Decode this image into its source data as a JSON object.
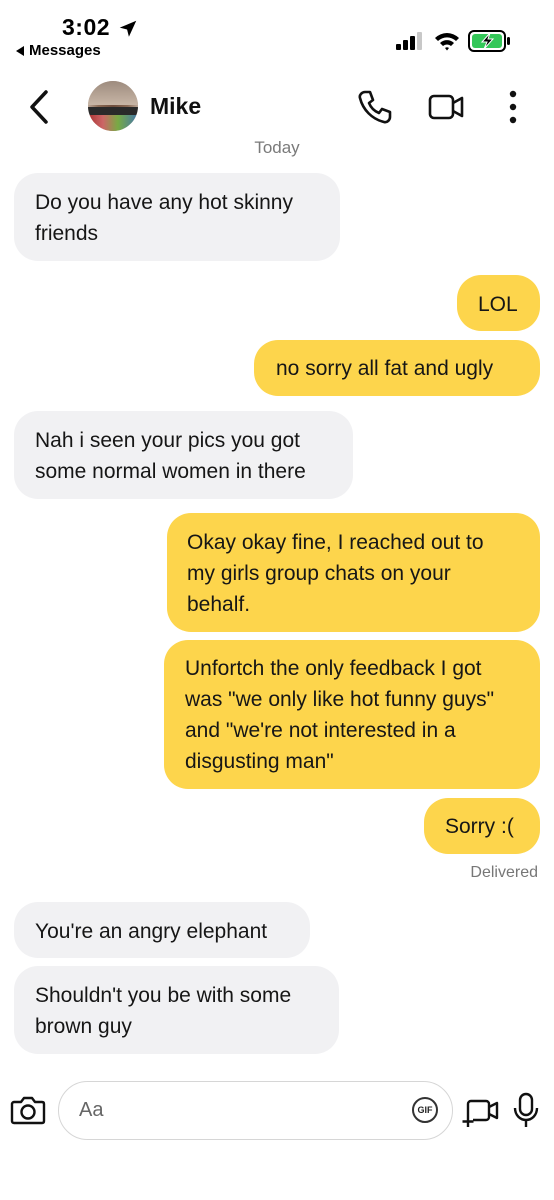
{
  "status_bar": {
    "time": "3:02",
    "back_app_label": "Messages"
  },
  "header": {
    "contact_name": "Mike"
  },
  "conversation": {
    "date_label": "Today",
    "messages": [
      {
        "side": "in",
        "text": "Do you have any hot skinny\nfriends"
      },
      {
        "side": "out",
        "text": "LOL"
      },
      {
        "side": "out",
        "text": "no sorry all fat and ugly"
      },
      {
        "side": "in",
        "text": "Nah i seen your pics you got\nsome normal women in there"
      },
      {
        "side": "out",
        "text": "Okay okay fine, I reached out to\nmy girls group chats on your\nbehalf."
      },
      {
        "side": "out",
        "text": "Unfortch the only feedback I got\nwas \"we only like hot funny guys\"\nand \"we're not interested in a\ndisgusting man\""
      },
      {
        "side": "out",
        "text": "Sorry :("
      },
      {
        "side": "in",
        "text": "You're an angry elephant"
      },
      {
        "side": "in",
        "text": "Shouldn't you be with some\nbrown guy"
      }
    ],
    "delivered_label": "Delivered"
  },
  "composer": {
    "placeholder": "Aa",
    "gif_label": "GIF"
  },
  "colors": {
    "outgoing_bubble": "#fdd54c",
    "incoming_bubble": "#f1f1f3",
    "battery_green": "#34c759"
  }
}
